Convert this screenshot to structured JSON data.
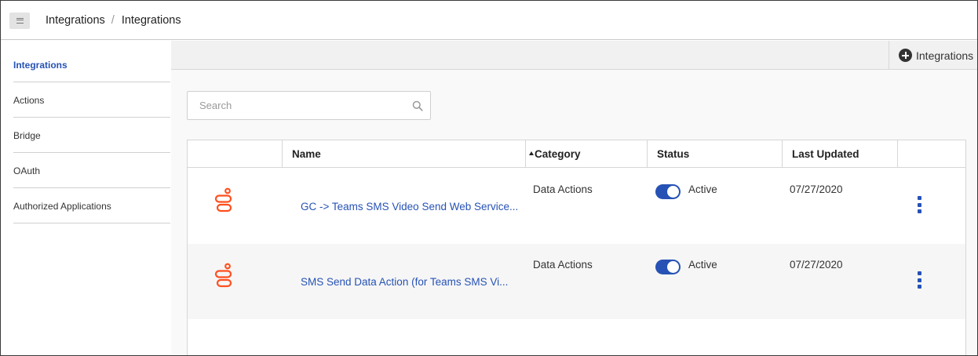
{
  "header": {
    "menu_icon": "hamburger-menu-icon",
    "breadcrumbs": [
      "Integrations",
      "Integrations"
    ],
    "separator": "/"
  },
  "sidebar": {
    "items": [
      {
        "label": "Integrations",
        "active": true
      },
      {
        "label": "Actions",
        "active": false
      },
      {
        "label": "Bridge",
        "active": false
      },
      {
        "label": "OAuth",
        "active": false
      },
      {
        "label": "Authorized Applications",
        "active": false
      }
    ]
  },
  "toolbar": {
    "add_button_label": "Integrations",
    "add_icon": "plus-circle-icon"
  },
  "search": {
    "placeholder": "Search",
    "value": "",
    "icon": "search-icon"
  },
  "table": {
    "columns": [
      {
        "label": "",
        "key": "logo"
      },
      {
        "label": "Name",
        "key": "name"
      },
      {
        "label": "Category",
        "key": "category",
        "sorted": "ascending"
      },
      {
        "label": "Status",
        "key": "status"
      },
      {
        "label": "Last Updated",
        "key": "last_updated"
      },
      {
        "label": "",
        "key": "actions"
      }
    ],
    "rows": [
      {
        "logo": "genesys-logo-icon",
        "name": "GC -> Teams SMS Video Send Web Service...",
        "category": "Data Actions",
        "status_enabled": true,
        "status": "Active",
        "last_updated": "07/27/2020",
        "actions_icon": "more-vertical-icon"
      },
      {
        "logo": "genesys-logo-icon",
        "name": "SMS Send Data Action (for Teams SMS Vi...",
        "category": "Data Actions",
        "status_enabled": true,
        "status": "Active",
        "last_updated": "07/27/2020",
        "actions_icon": "more-vertical-icon"
      }
    ]
  },
  "colors": {
    "accent": "#2652b5",
    "logo_orange": "#ff4f1f",
    "row_alt": "#f6f6f6"
  }
}
